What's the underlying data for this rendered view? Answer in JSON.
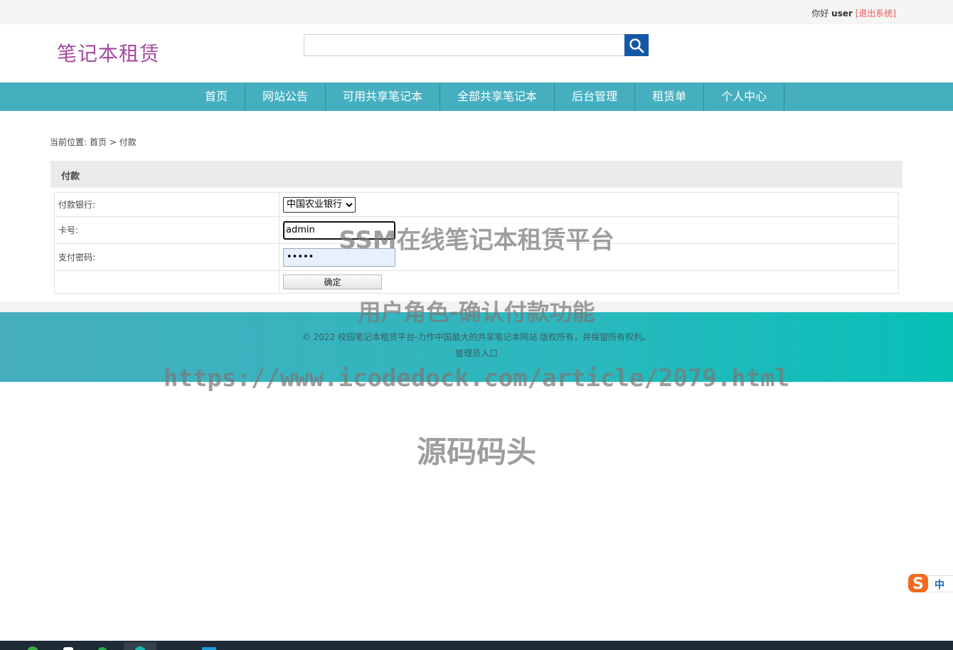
{
  "topbar": {
    "greeting": "你好",
    "username": "user",
    "logout": "[退出系统]"
  },
  "header": {
    "logo": "笔记本租赁",
    "search": {
      "value": "",
      "placeholder": ""
    }
  },
  "nav": {
    "items": [
      "首页",
      "网站公告",
      "可用共享笔记本",
      "全部共享笔记本",
      "后台管理",
      "租赁单",
      "个人中心"
    ]
  },
  "breadcrumb": {
    "prefix": "当前位置:",
    "home": "首页",
    "separator": ">",
    "current": "付款"
  },
  "panel": {
    "title": "付款",
    "fields": {
      "bank_label": "付款银行:",
      "bank_value": "中国农业银行",
      "card_label": "卡号:",
      "card_value": "admin",
      "pwd_label": "支付密码:",
      "pwd_value": "•••••"
    },
    "submit": "确定"
  },
  "footer": {
    "copyright": "© 2022 校园笔记本租赁平台-力作中国最大的共享笔记本网站 版权所有，并保留所有权利。",
    "admin_entry": "管理员入口"
  },
  "watermarks": {
    "line1": "SSM在线笔记本租赁平台",
    "line2": "用户角色-确认付款功能",
    "line3": "https://www.icodedock.com/article/2079.html",
    "line4": "源码码头"
  },
  "ime": {
    "label": "中"
  },
  "colors": {
    "nav_bg": "#45afc0",
    "logo": "#a44a9e",
    "search_button": "#1657a6",
    "logout": "#e8585a",
    "footer_start": "#46aebf",
    "footer_end": "#06c0b6"
  },
  "icons": {
    "search": "search-icon",
    "ime": "sogou-ime-icon"
  }
}
